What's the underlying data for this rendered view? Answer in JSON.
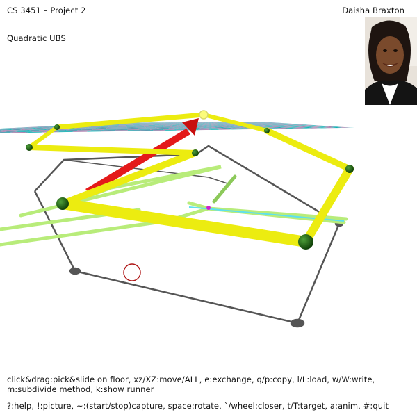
{
  "header": {
    "course_title": "CS 3451 – Project 2",
    "author_name": "Daisha Braxton",
    "scheme_name": "Quadratic UBS"
  },
  "help": {
    "line1": "click&drag:pick&slide on floor, xz/XZ:move/ALL, e:exchange, q/p:copy, l/L:load, w/W:write,",
    "line1b": "m:subdivide method, k:show runner",
    "line2": "?:help, !:picture, ~:(start/stop)capture, space:rotate, `/wheel:closer, t/T:target, a:anim, #:quit"
  },
  "colors": {
    "floor_pink": "#b07fae",
    "floor_teal": "#10b2b4",
    "control_tube": "#ecec10",
    "control_vertex": "#1f5f12",
    "subdivision_curve": "#b8ec7a",
    "arrow": "#e41a1a",
    "shadow": "#555555",
    "runner_ball": "#ffffff",
    "runner_outline": "#b01818"
  },
  "icons": {
    "author_photo": "portrait-photo"
  }
}
